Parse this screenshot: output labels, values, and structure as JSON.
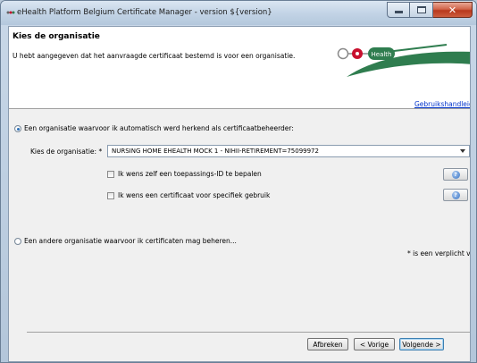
{
  "window": {
    "title": "eHealth Platform Belgium Certificate Manager - version ${version}",
    "controls": {
      "minimize": "minimize-icon",
      "maximize": "maximize-icon",
      "close": "close-icon"
    }
  },
  "header": {
    "title": "Kies de organisatie",
    "description": "U hebt aangegeven dat het aanvraagde certificaat bestemd is voor een organisatie.",
    "help_link": "Gebruikshandleidi",
    "logo_text": "Health"
  },
  "options": {
    "auto_org": {
      "label": "Een organisatie waarvoor ik automatisch werd herkend als certificaatbeheerder:",
      "checked": true
    },
    "other_org": {
      "label": "Een andere organisatie waarvoor ik certificaten mag beheren...",
      "checked": false
    }
  },
  "form": {
    "org_label": "Kies de organisatie: *",
    "org_value": "NURSING HOME EHEALTH MOCK 1 - NIHII-RETIREMENT=75099972",
    "checkbox_app_id": {
      "label": "Ik wens zelf een toepassings-ID te bepalen",
      "checked": false
    },
    "checkbox_specific": {
      "label": "Ik wens een certificaat voor specifiek gebruik",
      "checked": false
    },
    "required_note": "* is een verplicht veld"
  },
  "buttons": {
    "cancel": "Afbreken",
    "previous": "< Vorige",
    "next": "Volgende >"
  },
  "colors": {
    "link": "#0033cc",
    "logo_green": "#2f7d4f",
    "logo_red": "#c8102e"
  }
}
